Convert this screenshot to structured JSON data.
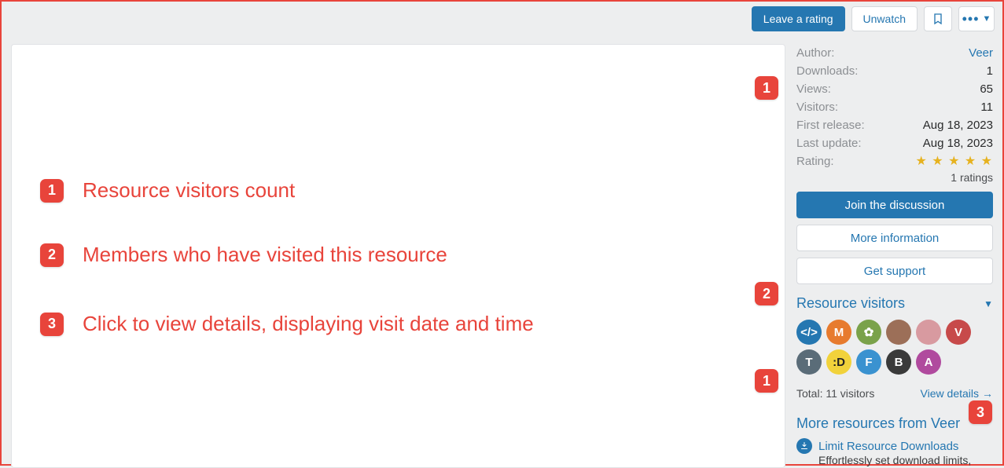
{
  "topbar": {
    "leave_rating": "Leave a rating",
    "unwatch": "Unwatch"
  },
  "info": {
    "author_label": "Author:",
    "author_value": "Veer",
    "downloads_label": "Downloads:",
    "downloads_value": "1",
    "views_label": "Views:",
    "views_value": "65",
    "visitors_label": "Visitors:",
    "visitors_value": "11",
    "first_release_label": "First release:",
    "first_release_value": "Aug 18, 2023",
    "last_update_label": "Last update:",
    "last_update_value": "Aug 18, 2023",
    "rating_label": "Rating:",
    "stars": "★ ★ ★ ★ ★",
    "ratings_text": "1 ratings"
  },
  "actions": {
    "join": "Join the discussion",
    "more_info": "More information",
    "get_support": "Get support"
  },
  "visitors_section": {
    "title": "Resource visitors",
    "total_text": "Total: 11 visitors",
    "view_details": "View details",
    "avatars": [
      "</>",
      "M",
      "✿",
      "",
      "",
      "V",
      "T",
      ":D",
      "F",
      "B",
      "A"
    ]
  },
  "more_resources": {
    "title": "More resources from Veer",
    "item_title": "Limit Resource Downloads",
    "item_desc": "Effortlessly set download limits,"
  },
  "callouts": {
    "c1": "Resource visitors count",
    "c2": "Members who have visited this resource",
    "c3": "Click to view details, displaying visit date and time"
  },
  "avatar_colors": [
    "#2577b1",
    "#e77b2e",
    "#7aa24a",
    "#9c6f58",
    "#d89aa0",
    "#c74a4a",
    "#5a6c78",
    "#f1d23b",
    "#3a92d0",
    "#3a3a3a",
    "#b04a9e"
  ]
}
